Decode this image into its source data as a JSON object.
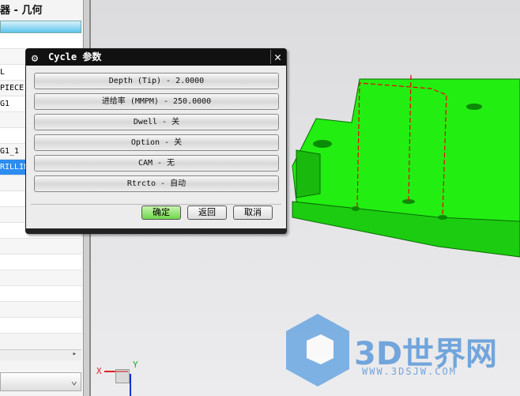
{
  "navigator": {
    "title": "器 - 几何",
    "rows": [
      "",
      "",
      "L",
      "PIECE",
      "G1",
      "",
      "",
      "G1_1",
      "RILLIN",
      "",
      "",
      "",
      "",
      "",
      "",
      "",
      "",
      "",
      ""
    ]
  },
  "dialog": {
    "title": "Cycle 参数",
    "buttons": [
      "Depth (Tip) - 2.0000",
      "进给率 (MMPM) - 250.0000",
      "Dwell - 关",
      "Option - 关",
      "CAM - 无",
      "Rtrcto - 自动"
    ],
    "ok": "确定",
    "back": "返回",
    "cancel": "取消"
  },
  "triad": {
    "x": "X",
    "y": "Y"
  },
  "watermark": {
    "brand": "3D世界网",
    "url": "WWW.3DSJW.COM"
  },
  "colors": {
    "part": "#22ee11",
    "ok": "#6ed64a"
  }
}
